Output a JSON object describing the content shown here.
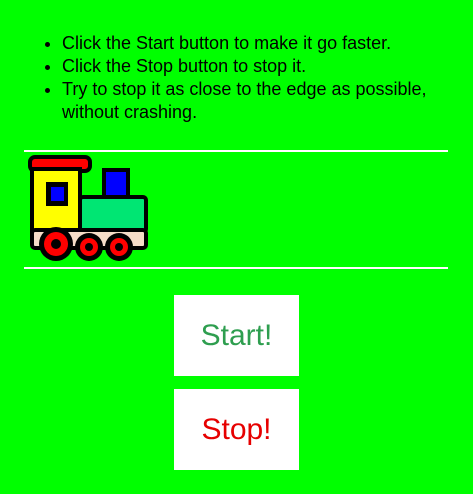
{
  "instructions": [
    "Click the Start button to make it go faster.",
    "Click the Stop button to stop it.",
    "Try to stop it as close to the edge as possible, without crashing."
  ],
  "train": {
    "icon": "train-icon",
    "colors": {
      "roof": "#ff0000",
      "cab": "#ffff00",
      "boiler": "#00e673",
      "windows": "#0000ff",
      "base": "#f5dcc8",
      "wheels": "#ff0000"
    }
  },
  "buttons": {
    "start_label": "Start!",
    "start_color": "#2e9e4f",
    "stop_label": "Stop!",
    "stop_color": "#e60000"
  },
  "colors": {
    "background": "#00ff00",
    "rule": "#ffffff"
  }
}
